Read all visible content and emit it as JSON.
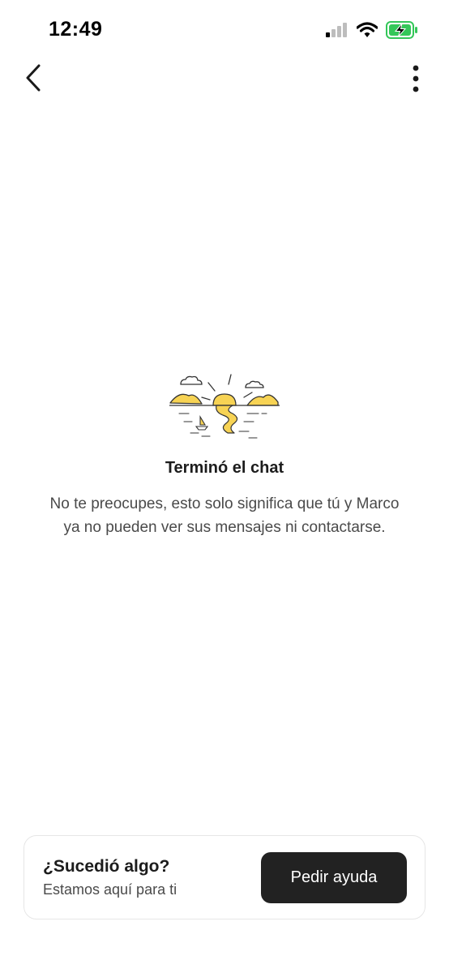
{
  "status_bar": {
    "time": "12:49",
    "icons": [
      "cellular-signal-icon",
      "wifi-icon",
      "battery-charging-icon"
    ],
    "battery_color": "#34c759"
  },
  "nav": {
    "back_icon": "chevron-left-icon",
    "more_icon": "vertical-ellipsis-icon"
  },
  "empty_state": {
    "illustration": "sunset-over-sea-icon",
    "accent_color": "#f7d354",
    "title": "Terminó el chat",
    "body": "No te preocupes, esto solo significa que tú y Marco ya no pueden ver sus mensajes ni contactarse."
  },
  "help_card": {
    "title": "¿Sucedió algo?",
    "subtitle": "Estamos aquí para ti",
    "button_label": "Pedir ayuda",
    "button_color": "#222222"
  }
}
